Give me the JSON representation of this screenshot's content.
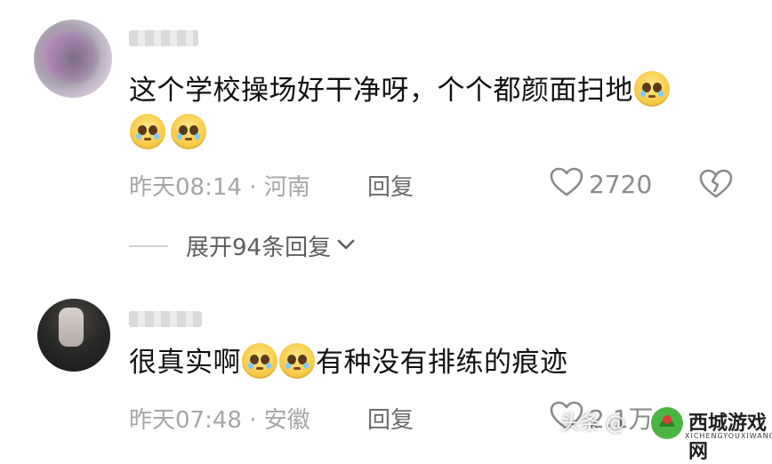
{
  "comments": [
    {
      "text": "这个学校操场好干净呀，个个都颜面扫地",
      "meta": "昨天08:14 · 河南",
      "reply_label": "回复",
      "like_count": "2720",
      "expand_text": "展开94条回复"
    },
    {
      "text_before": "很真实啊",
      "text_after": "有种没有排练的痕迹",
      "meta": "昨天07:48 · 安徽",
      "reply_label": "回复",
      "like_count": "2.1万"
    }
  ],
  "watermark": {
    "prefix": "头条 @",
    "brand": "西城游戏网",
    "sub": "XICHENGYOUXIWANG"
  },
  "icons": {
    "like": "heart-outline-icon",
    "dislike": "broken-heart-icon",
    "expand": "chevron-down-icon",
    "emoji": "pleading-face-emoji"
  },
  "colors": {
    "text": "#111111",
    "meta": "#a6a6a6",
    "reply": "#6c6c6c",
    "emoji": "#f7c844"
  }
}
